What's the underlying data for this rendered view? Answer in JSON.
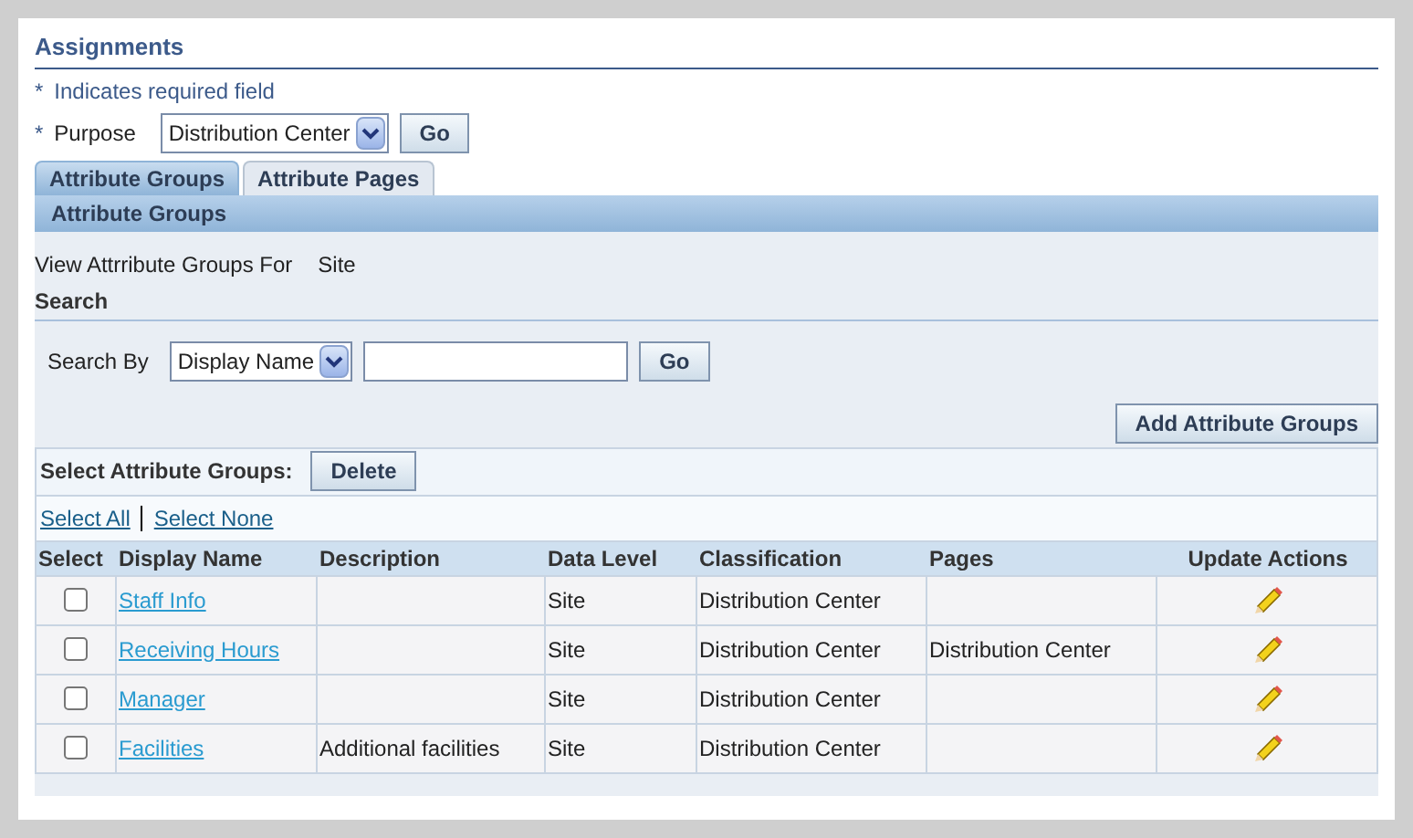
{
  "page_title": "Assignments",
  "required_note": {
    "mark": "*",
    "text": "Indicates required field"
  },
  "purpose": {
    "mark": "*",
    "label": "Purpose",
    "value": "Distribution Center",
    "button": "Go"
  },
  "tabs": [
    {
      "label": "Attribute Groups",
      "selected": true
    },
    {
      "label": "Attribute Pages",
      "selected": false
    }
  ],
  "section_title": "Attribute Groups",
  "view_for": {
    "label": "View Attrribute Groups For",
    "value": "Site"
  },
  "search": {
    "title": "Search",
    "label": "Search By",
    "by": "Display Name",
    "button": "Go"
  },
  "add_button": "Add Attribute Groups",
  "select_bar": {
    "label": "Select Attribute Groups:",
    "button": "Delete"
  },
  "select_links": [
    "Select All",
    "Select None"
  ],
  "table": {
    "columns": [
      "Select",
      "Display Name",
      "Description",
      "Data Level",
      "Classification",
      "Pages",
      "Update Actions"
    ],
    "rows": [
      {
        "checked": false,
        "name": "Staff Info",
        "description": "",
        "level": "Site",
        "classification": "Distribution Center",
        "pages": ""
      },
      {
        "checked": false,
        "name": "Receiving Hours",
        "description": "",
        "level": "Site",
        "classification": "Distribution Center",
        "pages": "Distribution Center"
      },
      {
        "checked": false,
        "name": "Manager",
        "description": "",
        "level": "Site",
        "classification": "Distribution Center",
        "pages": ""
      },
      {
        "checked": false,
        "name": "Facilities",
        "description": "Additional facilities",
        "level": "Site",
        "classification": "Distribution Center",
        "pages": ""
      }
    ]
  }
}
